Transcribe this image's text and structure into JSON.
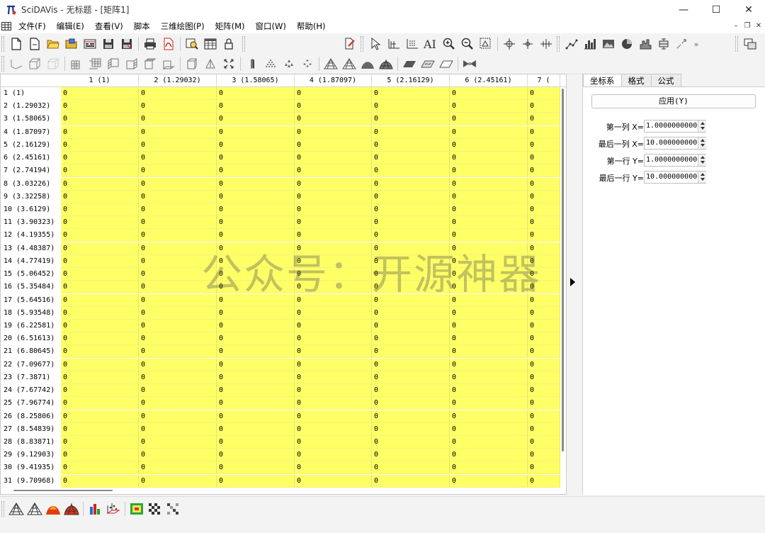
{
  "title": {
    "text": "SciDAVis - 无标题 - [矩阵1]",
    "minimize": "—",
    "maximize": "☐",
    "close": "✕"
  },
  "menu": {
    "items": [
      "文件(F)",
      "编辑(E)",
      "查看(V)",
      "脚本",
      "三维绘图(P)",
      "矩阵(M)",
      "窗口(W)",
      "帮助(H)"
    ],
    "mdi_minimize": "–",
    "mdi_restore": "❐",
    "mdi_close": "✕"
  },
  "toolbar1": {
    "icons": [
      "new-project-icon",
      "new-file-icon",
      "open-folder-icon",
      "open-template-icon",
      "recent-projects-icon",
      "save-icon",
      "save-as-icon",
      "print-icon",
      "export-pdf-icon",
      "find-icon",
      "table-icon",
      "lock-icon",
      "clear-icon",
      "pointer-icon",
      "data-reader-icon",
      "screen-reader-icon",
      "text-icon",
      "zoom-in-icon",
      "zoom-out-icon",
      "zoom-fit-icon",
      "crosshair-icon",
      "move-point-icon",
      "range-icon",
      "line-plot-icon",
      "bar-chart-icon",
      "image-plot-icon",
      "pie-chart-icon",
      "histogram-icon",
      "box-plot-icon",
      "vector-icon"
    ],
    "more": "»"
  },
  "toolbar2": {
    "more": "»"
  },
  "matrix": {
    "column_headers": [
      "1 (1)",
      "2 (1.29032)",
      "3 (1.58065)",
      "4 (1.87097)",
      "5 (2.16129)",
      "6 (2.45161)",
      "7 ("
    ],
    "row_headers": [
      "1 (1)",
      "2 (1.29032)",
      "3 (1.58065)",
      "4 (1.87097)",
      "5 (2.16129)",
      "6 (2.45161)",
      "7 (2.74194)",
      "8 (3.03226)",
      "9 (3.32258)",
      "10 (3.6129)",
      "11 (3.90323)",
      "12 (4.19355)",
      "13 (4.48387)",
      "14 (4.77419)",
      "15 (5.06452)",
      "16 (5.35484)",
      "17 (5.64516)",
      "18 (5.93548)",
      "19 (6.22581)",
      "20 (6.51613)",
      "21 (6.80645)",
      "22 (7.09677)",
      "23 (7.3871)",
      "24 (7.67742)",
      "25 (7.96774)",
      "26 (8.25806)",
      "27 (8.54839)",
      "28 (8.83871)",
      "29 (9.12903)",
      "30 (9.41935)",
      "31 (9.70968)"
    ],
    "cell_value": "0",
    "cell_color": "#ffff66"
  },
  "watermark": "公众号：开源神器",
  "side_panel": {
    "tabs": [
      "坐标系",
      "格式",
      "公式"
    ],
    "apply_label": "应用(Y)",
    "fields": [
      {
        "label": "第一列 X=",
        "value": "1.000000000000"
      },
      {
        "label": "最后一列 X=",
        "value": "10.00000000000"
      },
      {
        "label": "第一行 Y=",
        "value": "1.000000000000"
      },
      {
        "label": "最后一行 Y=",
        "value": "10.00000000000"
      }
    ]
  },
  "bottom_toolbar": {
    "icons": [
      "wireframe-plot-icon",
      "mesh-plot-icon",
      "surface-plot-icon",
      "colored-surface-icon",
      "bars-3d-icon",
      "scatter-3d-icon",
      "image-matrix-icon",
      "gray-map-icon",
      "contour-map-icon"
    ]
  }
}
